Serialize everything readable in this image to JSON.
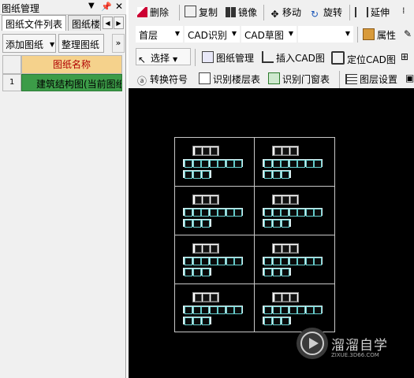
{
  "panel": {
    "title": "图纸管理",
    "pin_icon": "pin-icon",
    "close_icon": "close-icon",
    "tabs": [
      {
        "label": "图纸文件列表"
      },
      {
        "label": "图纸楼"
      }
    ],
    "buttons": {
      "add": "添加图纸",
      "organize": "整理图纸",
      "more": "»"
    },
    "grid": {
      "header": "图纸名称",
      "rows": [
        {
          "index": "1",
          "name": "建筑结构图(当前图纸)"
        }
      ]
    }
  },
  "toolbar": {
    "row1": [
      {
        "label": "删除",
        "icon": "eraser-icon"
      },
      {
        "label": "复制",
        "icon": "copy-icon"
      },
      {
        "label": "镜像",
        "icon": "mirror-icon"
      },
      {
        "label": "移动",
        "icon": "move-icon"
      },
      {
        "label": "旋转",
        "icon": "rotate-icon"
      },
      {
        "label": "延伸",
        "icon": "extend-icon"
      }
    ],
    "row2": {
      "floor": "首层",
      "cad_recognize": "CAD识别",
      "cad_sketch": "CAD草图",
      "blank": "",
      "properties": "属性"
    },
    "row3": [
      {
        "label": "选择",
        "icon": "cursor-icon"
      },
      {
        "label": "图纸管理",
        "icon": "drawing-manage-icon"
      },
      {
        "label": "插入CAD图",
        "icon": "insert-cad-icon"
      },
      {
        "label": "定位CAD图",
        "icon": "locate-cad-icon"
      }
    ],
    "row4": [
      {
        "label": "转换符号",
        "icon": "convert-symbol-icon"
      },
      {
        "label": "识别楼层表",
        "icon": "floor-table-icon"
      },
      {
        "label": "识别门窗表",
        "icon": "door-window-icon"
      },
      {
        "label": "图层设置",
        "icon": "layer-settings-icon"
      }
    ]
  },
  "watermark": {
    "brand": "溜溜自学",
    "url": "ZIXUE.3D66.COM"
  },
  "colors": {
    "grid_header": "#f5d28c",
    "selected_row": "#3c9c48",
    "canvas": "#000000"
  }
}
